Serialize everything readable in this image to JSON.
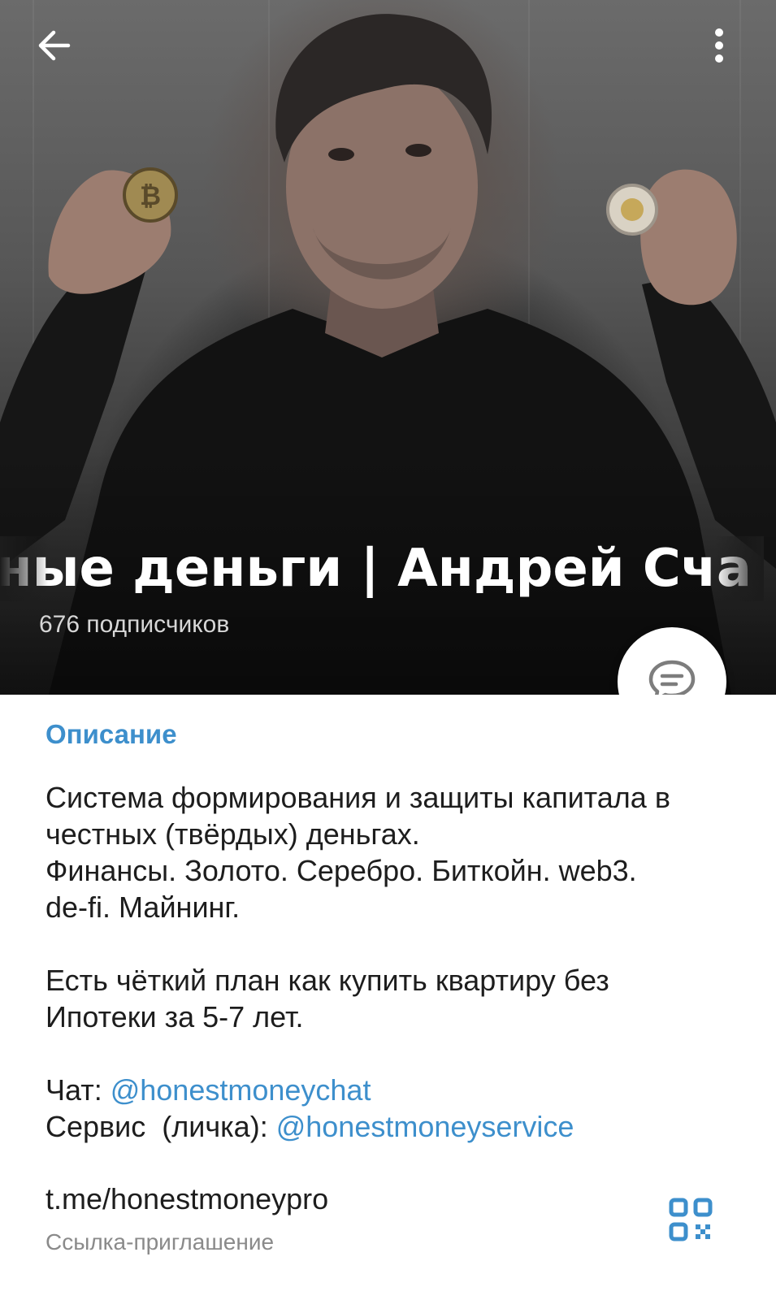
{
  "header": {
    "title": "тные деньги | Андрей Сча",
    "subscribers": "676 подписчиков",
    "back_icon": "arrow-left-icon",
    "menu_icon": "more-vertical-icon",
    "fab_icon": "chat-bubble-icon"
  },
  "description": {
    "section_title": "Описание",
    "lines": [
      "Система формирования и защиты капитала в",
      "честных (твёрдых) деньгах.",
      "Финансы. Золото. Серебро. Биткойн. web3.",
      "de-fi. Майнинг.",
      "Есть чёткий план как купить квартиру без",
      "Ипотеки за 5-7 лет."
    ],
    "chat_label": "Чат: ",
    "chat_mention": "@honestmoneychat",
    "service_label": "Сервис  (личка): ",
    "service_mention": "@honestmoneyservice"
  },
  "invite": {
    "link": "t.me/honestmoneypro",
    "label": "Ссылка-приглашение",
    "qr_icon": "qr-code-icon"
  },
  "colors": {
    "accent": "#3d8fcc",
    "text": "#1d1d1d",
    "muted": "#8a8a8a"
  }
}
